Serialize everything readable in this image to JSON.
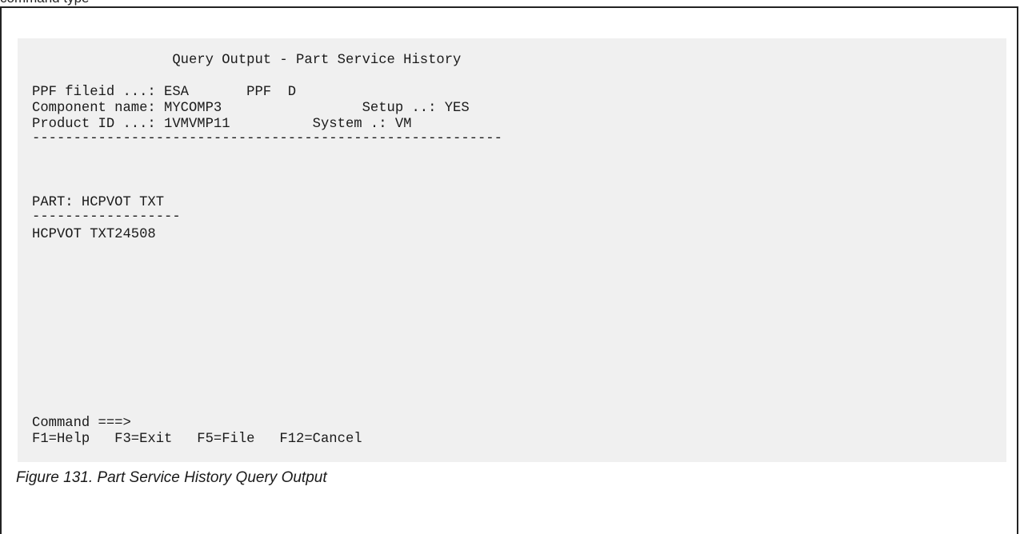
{
  "top_caption": "command type",
  "screen": {
    "title": "                 Query Output - Part Service History",
    "header_lines": [
      "PPF fileid ...: ESA       PPF  D",
      "Component name: MYCOMP3                 Setup ..: YES",
      "Product ID ...: 1VMVMP11          System .: VM"
    ],
    "separator": "---------------------------------------------------------",
    "part_label": "PART: HCPVOT TXT",
    "part_separator": "------------------",
    "part_entry": "HCPVOT TXT24508",
    "command_line": "Command ===>",
    "pf_keys": [
      {
        "key": "F1",
        "action": "Help"
      },
      {
        "key": "F3",
        "action": "Exit"
      },
      {
        "key": "F5",
        "action": "File"
      },
      {
        "key": "F12",
        "action": "Cancel"
      }
    ],
    "pf_keys_text": "F1=Help   F3=Exit   F5=File   F12=Cancel"
  },
  "figure_caption": "Figure 131. Part Service History Query Output"
}
